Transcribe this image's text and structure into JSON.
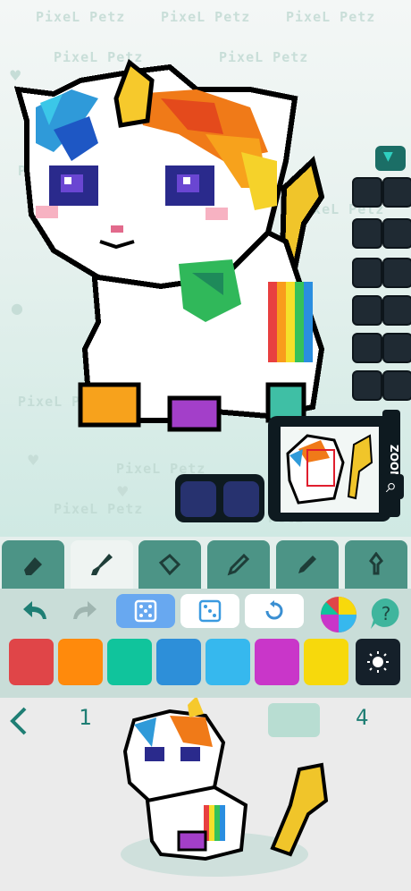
{
  "app": {
    "watermark": "PixeL Petz"
  },
  "canvas": {
    "background_top": "#f4f7f6",
    "background_bottom": "#cfe9e3"
  },
  "zoom": {
    "label": "ZOOM",
    "icon": "magnifier-icon"
  },
  "toolbar": {
    "tools": [
      {
        "name": "eraser",
        "icon": "eraser-icon",
        "active": false
      },
      {
        "name": "brush",
        "icon": "brush-icon",
        "active": true
      },
      {
        "name": "fill",
        "icon": "bucket-icon",
        "active": false
      },
      {
        "name": "pencil",
        "icon": "pencil-icon",
        "active": false
      },
      {
        "name": "marker",
        "icon": "marker-icon",
        "active": false
      },
      {
        "name": "pin",
        "icon": "pin-icon",
        "active": false
      }
    ]
  },
  "actions": {
    "undo_icon": "undo-icon",
    "redo_icon": "redo-icon",
    "random_icon": "dice-icon",
    "reset_icon": "reset-icon",
    "color_wheel_icon": "color-wheel-icon",
    "help_icon": "help-icon"
  },
  "palette": {
    "colors": [
      "#e04548",
      "#ff8a0c",
      "#10c49c",
      "#2d8fd9",
      "#36b8ee",
      "#c936c9",
      "#f7d90c"
    ],
    "brightness_icon": "brightness-icon",
    "accent": "#1e7e74"
  },
  "pager": {
    "prev_icon": "chevron-left-icon",
    "pages": [
      "1",
      "4"
    ]
  }
}
